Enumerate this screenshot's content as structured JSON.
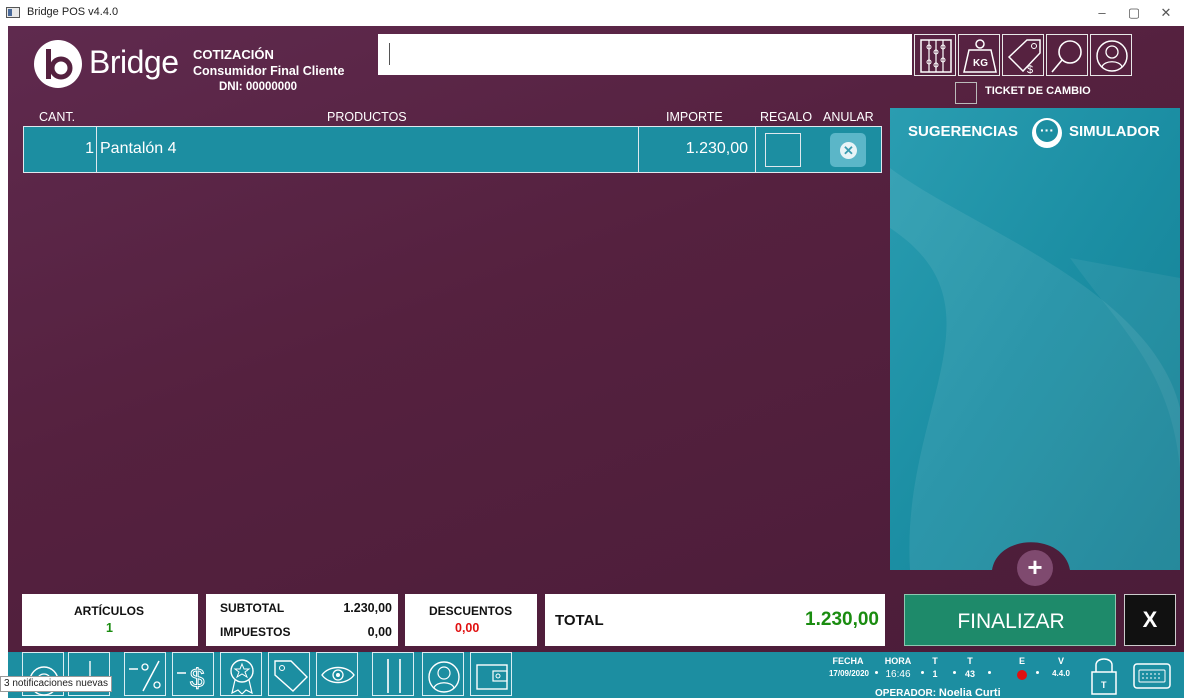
{
  "window": {
    "title": "Bridge POS v4.4.0",
    "minimize": "–",
    "maximize": "▢",
    "close": "✕"
  },
  "header": {
    "brand": "Bridge",
    "doc_type": "COTIZACIÓN",
    "client": "Consumidor Final Cliente",
    "dni": "DNI: 00000000",
    "search_value": "",
    "tools": [
      "abacus-icon",
      "scale-kg-icon",
      "price-tag-icon",
      "magnifier-icon",
      "customer-icon"
    ],
    "ticket_label": "TICKET DE CAMBIO"
  },
  "table": {
    "headers": {
      "qty": "CANT.",
      "products": "PRODUCTOS",
      "amount": "IMPORTE",
      "gift": "REGALO",
      "cancel": "ANULAR"
    },
    "rows": [
      {
        "qty": "1",
        "product": "Pantalón 4",
        "amount": "1.230,00",
        "gift": false
      }
    ]
  },
  "suggestions": {
    "title": "SUGERENCIAS",
    "simulator": "SIMULADOR",
    "add": "+"
  },
  "summary": {
    "articles_label": "ARTÍCULOS",
    "articles_value": "1",
    "subtotal_label": "SUBTOTAL",
    "subtotal_value": "1.230,00",
    "taxes_label": "IMPUESTOS",
    "taxes_value": "0,00",
    "discounts_label": "DESCUENTOS",
    "discounts_value": "0,00",
    "total_label": "TOTAL",
    "total_value": "1.230,00",
    "finalize": "FINALIZAR",
    "close": "X"
  },
  "status": {
    "date_label": "FECHA",
    "date": "17/09/2020",
    "time_label": "HORA",
    "time": "16:46",
    "t1_label": "T",
    "t1": "1",
    "t2_label": "T",
    "t2": "43",
    "e_label": "E",
    "v_label": "V",
    "version": "4.4.0",
    "operator_label": "OPERADOR:",
    "operator": "Noelia Curti"
  },
  "notification": "3 notificaciones nuevas",
  "colors": {
    "background": "#55213f",
    "teal": "#1c8ea1",
    "finalize": "#1e8a6a",
    "total_green": "#1a8c10",
    "discount_red": "#e01010"
  }
}
